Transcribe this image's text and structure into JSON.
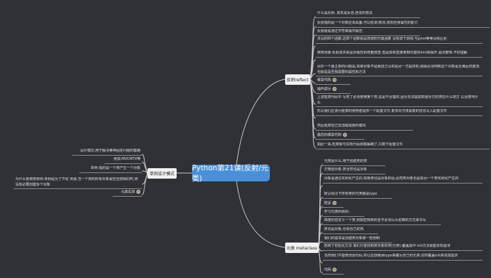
{
  "central": "Python第21课(反射/元类)",
  "reflect": {
    "label": "反射reflect",
    "items": [
      "什么是反射, 其实是反省,自省的意思",
      "反射指的是一个对象应该具备,可以检测,修改,增加自身属性的能力",
      "反射就是通过字符串操作属性",
      "涉及的四个函数,这四个函数就是普通的内置函数 没有双下划线,与print等等没有区别",
      "使用场景:反射其实就是对属性的增删改查,但是如果直接使用内置的dict来操作,语法繁琐,不好理解",
      "另外一个最主要的问题是,如果对象不是我自己写的是另一方提供的,我就必须判断这个对象是否满足的要求,也就是是否我需要的属性和方法",
      "框架代码",
      "插件部分",
      "上述框架代码中 写死了必须使用某个类,这是不合理的,因为无法提前知道对方的类在什么地方 以及类叫什么",
      "所以我们应该为框架的使用者提供一个配置文件,要求对方将需要的信息写入配置文件",
      "然后框架自己去加载需要的模块",
      "最后的框架代码",
      "如此一来,框架就与实现代码彻底解耦了,只剩下配置文件"
    ]
  },
  "singleton": {
    "label": "单例设计模式",
    "items": [
      "设计模式:用于解决某种固定问题的套路",
      "例如:MVCMTV等",
      "单例:指的是一个类产生一个对象",
      "为什么要使用单例:单例是为了节省 资源,当一个类的所有对象属性全部相同时,则没有必要创建多个对象",
      "元类实现"
    ]
  },
  "metaclass": {
    "label": "元类 metaclass",
    "items": [
      "元类是什么,用于创建类的类",
      "万物皆对象,类当然也是对象",
      "对象是通过实例化产生的,如果类也是对象的话,必然类对象也是有另一个类实例化产生的",
      "默认情况下所有类的元类都是type",
      "验证",
      "学习元类的目的:",
      "高度的自定义一个类,例如控制类的名字必须以大驼峰的方式来书写",
      "类也是对象,也有自己的类,",
      "我们的需求是创建类对象做一些限制",
      "想到了初始化方法 我们只要找到类对象的类(元类),覆盖其中 init方法就能实现需求",
      "当然我们不能修改源代码,所以应该继承type来编写自己的元类,同时覆盖init来完成需求",
      "代码"
    ]
  }
}
